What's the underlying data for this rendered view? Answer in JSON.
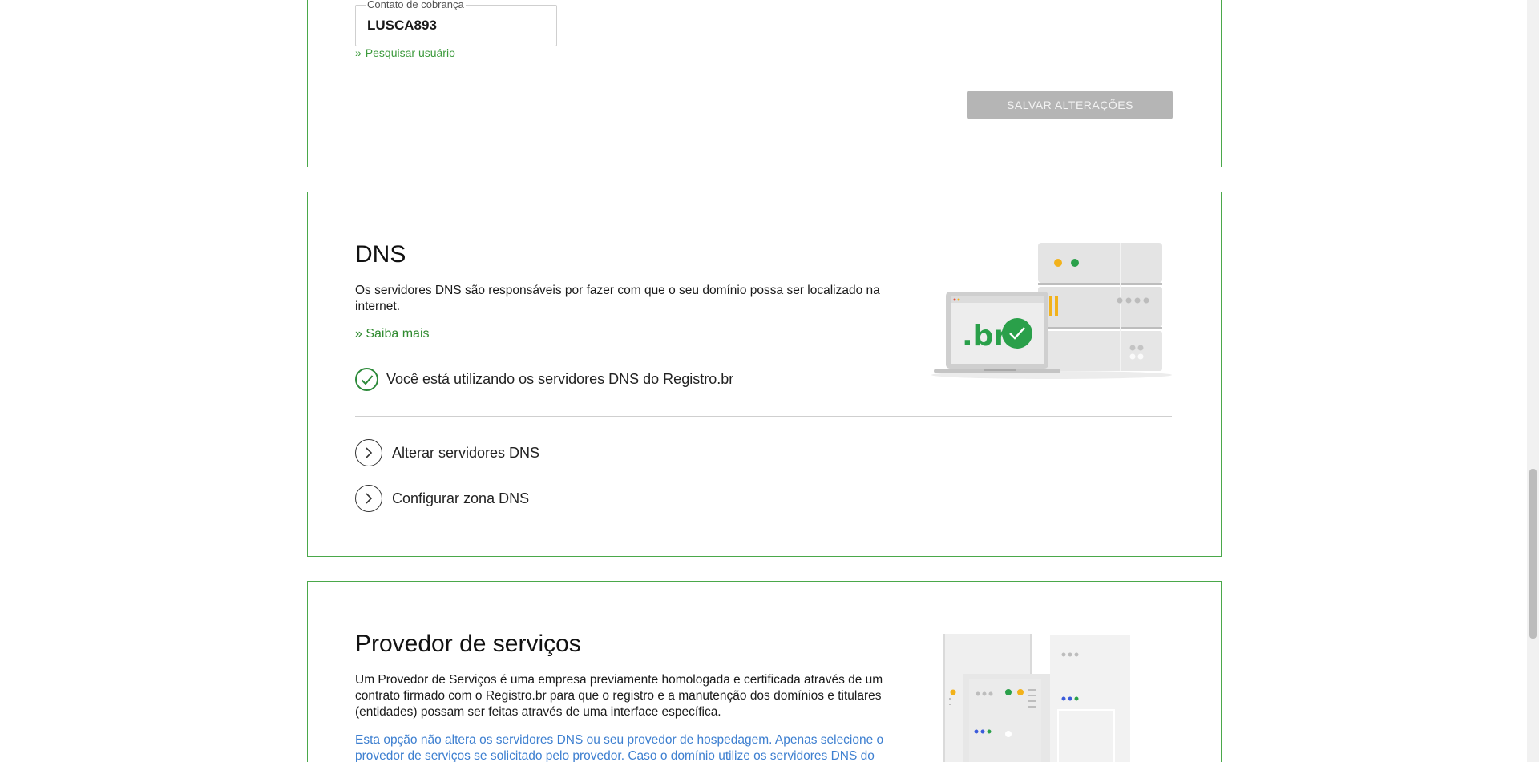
{
  "contact": {
    "field_label": "Contato de cobrança",
    "field_value": "LUSCA893",
    "search_link": "Pesquisar usuário",
    "save_button": "SALVAR ALTERAÇÕES"
  },
  "dns": {
    "title": "DNS",
    "description": "Os servidores DNS são responsáveis por fazer com que o seu domínio possa ser localizado na internet.",
    "learn_more": "» Saiba mais",
    "status": "Você está utilizando os servidores DNS do Registro.br",
    "actions": [
      {
        "label": "Alterar servidores DNS"
      },
      {
        "label": "Configurar zona DNS"
      }
    ]
  },
  "provider": {
    "title": "Provedor de serviços",
    "description": "Um Provedor de Serviços é uma empresa previamente homologada e certificada através de um contrato firmado com o Registro.br para que o registro e a manutenção dos domínios e titulares (entidades) possam ser feitas através de uma interface específica.",
    "note": "Esta opção não altera os servidores DNS ou seu provedor de hospedagem. Apenas selecione o provedor de serviços se solicitado pelo provedor. Caso o domínio utilize os servidores DNS do"
  },
  "colors": {
    "border_green": "#4aa84a",
    "link_green": "#2f8a2f",
    "note_blue": "#3d7fd0",
    "disabled_button": "#b5b5b5"
  },
  "illustration_text": {
    "laptop_logo": ".br"
  }
}
